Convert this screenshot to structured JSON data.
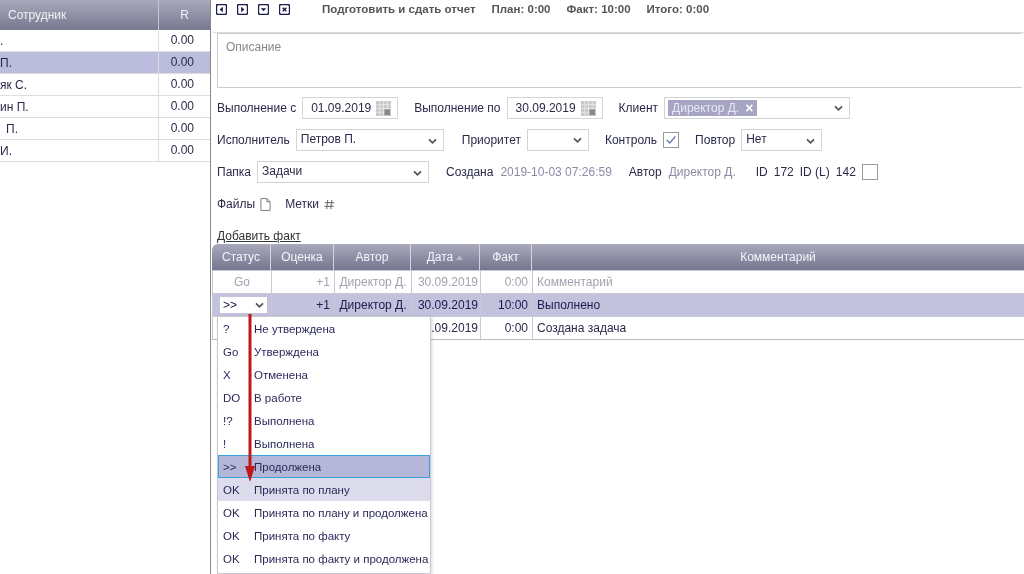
{
  "employees": {
    "columns": [
      "Сотрудник",
      "R"
    ],
    "rows": [
      {
        "name": ".",
        "r": "0.00",
        "selected": false
      },
      {
        "name": "П.",
        "r": "0.00",
        "selected": true
      },
      {
        "name": "як С.",
        "r": "0.00",
        "selected": false
      },
      {
        "name": "ин П.",
        "r": "0.00",
        "selected": false
      },
      {
        "name": "П.",
        "r": "0.00",
        "selected": false
      },
      {
        "name": "И.",
        "r": "0.00",
        "selected": false
      }
    ]
  },
  "toolbar": {
    "title": "Подготовить и сдать отчет",
    "plan": "План: 0:00",
    "fact": "Факт: 10:00",
    "total": "Итого: 0:00"
  },
  "description": {
    "placeholder": "Описание"
  },
  "form": {
    "start_label": "Выполнение с",
    "start": "01.09.2019",
    "end_label": "Выполнение по",
    "end": "30.09.2019",
    "client_label": "Клиент",
    "client_tag": "Директор Д.",
    "client_remove": "×",
    "executor_label": "Исполнитель",
    "executor": "Петров П.",
    "priority_label": "Приоритет",
    "control_label": "Контроль",
    "control_checked": true,
    "repeat_label": "Повтор",
    "repeat": "Нет",
    "folder_label": "Папка",
    "folder": "Задачи",
    "created_label": "Создана",
    "created": "2019-10-03 07:26:59",
    "author_label": "Автор",
    "author": "Директор Д.",
    "id_label": "ID",
    "id": "172",
    "idl_label": "ID (L)",
    "idl": "142",
    "idl_checked": false,
    "files_label": "Файлы",
    "tags_label": "Метки"
  },
  "add_fact": "Добавить факт",
  "facts": {
    "columns": [
      "Статус",
      "Оценка",
      "Автор",
      "Дата",
      "Факт",
      "Комментарий"
    ],
    "rows": [
      {
        "status": "Go",
        "score": "+1",
        "author": "Директор Д.",
        "date": "30.09.2019",
        "fact": "0:00",
        "comment": "Комментарий",
        "selected": false,
        "disabled": true
      },
      {
        "status": ">>",
        "score": "+1",
        "author": "Директор Д.",
        "date": "30.09.2019",
        "fact": "10:00",
        "comment": "Выполнено",
        "selected": true,
        "disabled": false
      },
      {
        "date": ".09.2019",
        "fact": "0:00",
        "comment": "Создана задача",
        "selected": false,
        "disabled": false
      }
    ]
  },
  "status_menu": [
    {
      "code": "?",
      "label": "Не утверждена",
      "selected": false,
      "hovered": false
    },
    {
      "code": "Go",
      "label": "Утверждена",
      "selected": false,
      "hovered": false
    },
    {
      "code": "X",
      "label": "Отменена",
      "selected": false,
      "hovered": false
    },
    {
      "code": "DO",
      "label": "В работе",
      "selected": false,
      "hovered": false
    },
    {
      "code": "!?",
      "label": "Выполнена",
      "selected": false,
      "hovered": false
    },
    {
      "code": "!",
      "label": "Выполнена",
      "selected": false,
      "hovered": false
    },
    {
      "code": ">>",
      "label": "Продолжена",
      "selected": true,
      "hovered": false
    },
    {
      "code": "OK",
      "label": "Принята по плану",
      "selected": false,
      "hovered": true
    },
    {
      "code": "OK",
      "label": "Принята по плану и продолжена",
      "selected": false,
      "hovered": false
    },
    {
      "code": "OK",
      "label": "Принята по факту",
      "selected": false,
      "hovered": false
    },
    {
      "code": "OK",
      "label": "Принята по факту и продолжена",
      "selected": false,
      "hovered": false
    }
  ]
}
